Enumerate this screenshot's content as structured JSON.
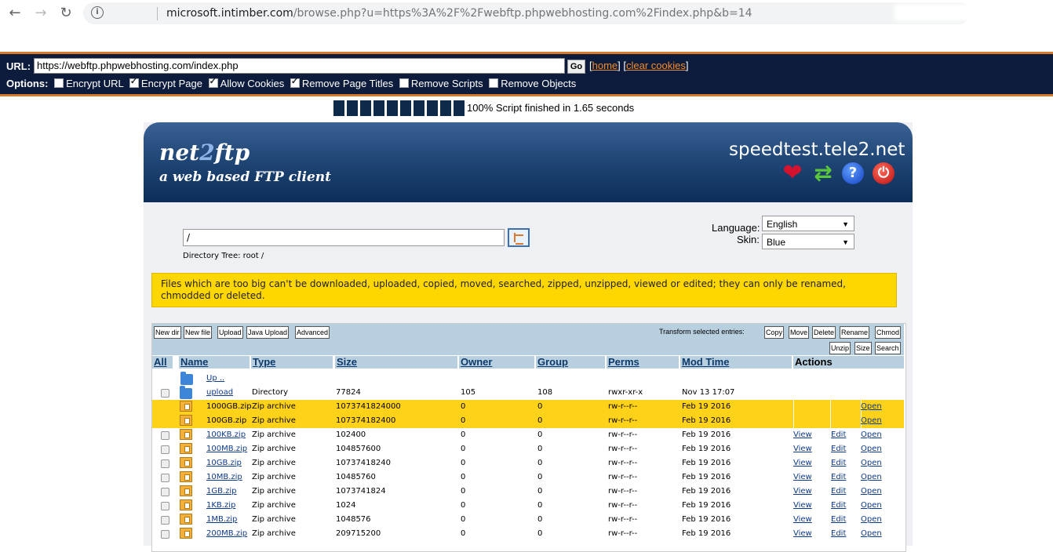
{
  "browser": {
    "url_host": "microsoft.intimber.com",
    "url_path": "/browse.php?u=https%3A%2F%2Fwebftp.phpwebhosting.com%2Findex.php&b=14"
  },
  "proxy": {
    "url_label": "URL:",
    "url_value": "https://webftp.phpwebhosting.com/index.php",
    "go_label": "Go",
    "home_label": "home",
    "clear_cookies_label": "clear cookies",
    "options_label": "Options:",
    "options": [
      {
        "label": "Encrypt URL",
        "checked": false
      },
      {
        "label": "Encrypt Page",
        "checked": true
      },
      {
        "label": "Allow Cookies",
        "checked": true
      },
      {
        "label": "Remove Page Titles",
        "checked": true
      },
      {
        "label": "Remove Scripts",
        "checked": false
      },
      {
        "label": "Remove Objects",
        "checked": false
      }
    ]
  },
  "progress": {
    "percent": 100,
    "blocks": 10,
    "text": "100% Script finished in 1.65 seconds"
  },
  "net2ftp": {
    "logo_net": "net",
    "logo_two": "2",
    "logo_ftp": "ftp",
    "tagline": "a web based FTP client",
    "hostname": "speedtest.tele2.net",
    "icons": [
      "heart-icon",
      "refresh-icon",
      "help-icon",
      "power-icon"
    ],
    "help_glyph": "?",
    "power_glyph": "⏻",
    "directory_value": "/",
    "directory_tree_label": "Directory Tree:",
    "directory_tree_root": "root",
    "directory_tree_sep": "/",
    "language_label": "Language:",
    "language_value": "English",
    "skin_label": "Skin:",
    "skin_value": "Blue",
    "warning": "Files which are too big can't be downloaded, uploaded, copied, moved, searched, zipped, unzipped, viewed or edited; they can only be renamed, chmodded or deleted."
  },
  "toolbar": {
    "left_buttons": [
      "New dir",
      "New file",
      "Upload",
      "Java Upload",
      "Advanced"
    ],
    "transform_label": "Transform selected entries:",
    "right_buttons_row1": [
      "Copy",
      "Move",
      "Delete",
      "Rename",
      "Chmod"
    ],
    "right_buttons_row2": [
      "Unzip",
      "Size",
      "Search"
    ]
  },
  "table": {
    "headers": {
      "all": "All",
      "name": "Name",
      "type": "Type",
      "size": "Size",
      "owner": "Owner",
      "group": "Group",
      "perms": "Perms",
      "mod_time": "Mod Time",
      "actions": "Actions"
    },
    "up_label": "Up ..",
    "action_labels": {
      "view": "View",
      "edit": "Edit",
      "open": "Open"
    },
    "rows": [
      {
        "name": "upload",
        "type": "Directory",
        "size": "77824",
        "owner": "105",
        "group": "108",
        "perms": "rwxr-xr-x",
        "mod": "Nov 13 17:07",
        "kind": "folder",
        "highlight": false
      },
      {
        "name": "1000GB.zip",
        "type": "Zip archive",
        "size": "1073741824000",
        "owner": "0",
        "group": "0",
        "perms": "rw-r--r--",
        "mod": "Feb 19 2016",
        "kind": "zip",
        "highlight": true
      },
      {
        "name": "100GB.zip",
        "type": "Zip archive",
        "size": "107374182400",
        "owner": "0",
        "group": "0",
        "perms": "rw-r--r--",
        "mod": "Feb 19 2016",
        "kind": "zip",
        "highlight": true
      },
      {
        "name": "100KB.zip",
        "type": "Zip archive",
        "size": "102400",
        "owner": "0",
        "group": "0",
        "perms": "rw-r--r--",
        "mod": "Feb 19 2016",
        "kind": "zip",
        "highlight": false
      },
      {
        "name": "100MB.zip",
        "type": "Zip archive",
        "size": "104857600",
        "owner": "0",
        "group": "0",
        "perms": "rw-r--r--",
        "mod": "Feb 19 2016",
        "kind": "zip",
        "highlight": false
      },
      {
        "name": "10GB.zip",
        "type": "Zip archive",
        "size": "10737418240",
        "owner": "0",
        "group": "0",
        "perms": "rw-r--r--",
        "mod": "Feb 19 2016",
        "kind": "zip",
        "highlight": false
      },
      {
        "name": "10MB.zip",
        "type": "Zip archive",
        "size": "10485760",
        "owner": "0",
        "group": "0",
        "perms": "rw-r--r--",
        "mod": "Feb 19 2016",
        "kind": "zip",
        "highlight": false
      },
      {
        "name": "1GB.zip",
        "type": "Zip archive",
        "size": "1073741824",
        "owner": "0",
        "group": "0",
        "perms": "rw-r--r--",
        "mod": "Feb 19 2016",
        "kind": "zip",
        "highlight": false
      },
      {
        "name": "1KB.zip",
        "type": "Zip archive",
        "size": "1024",
        "owner": "0",
        "group": "0",
        "perms": "rw-r--r--",
        "mod": "Feb 19 2016",
        "kind": "zip",
        "highlight": false
      },
      {
        "name": "1MB.zip",
        "type": "Zip archive",
        "size": "1048576",
        "owner": "0",
        "group": "0",
        "perms": "rw-r--r--",
        "mod": "Feb 19 2016",
        "kind": "zip",
        "highlight": false
      },
      {
        "name": "200MB.zip",
        "type": "Zip archive",
        "size": "209715200",
        "owner": "0",
        "group": "0",
        "perms": "rw-r--r--",
        "mod": "Feb 19 2016",
        "kind": "zip",
        "highlight": false
      }
    ]
  },
  "colors": {
    "header_dark": "#0c2d58",
    "proxy_bg": "#0d1c3c",
    "accent_orange": "#d87a2a",
    "highlight_row": "#ffd21a",
    "warning_bg": "#ffd700"
  }
}
